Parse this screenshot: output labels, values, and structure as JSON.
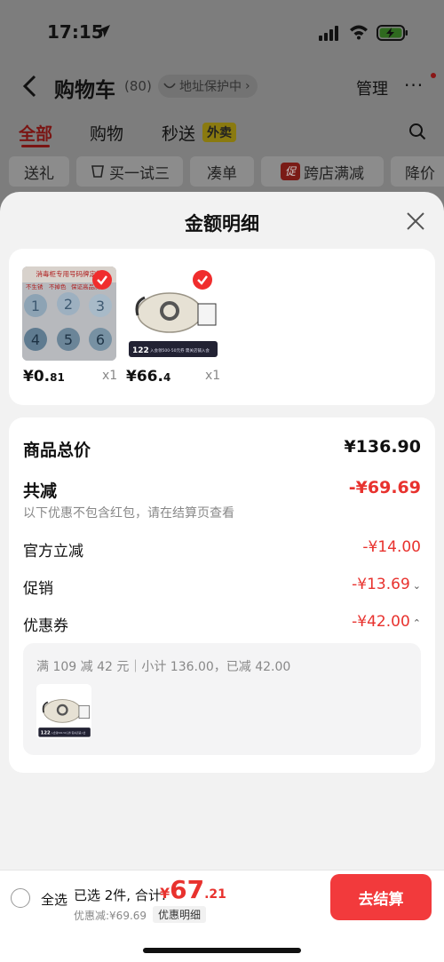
{
  "status": {
    "time": "17:15"
  },
  "nav": {
    "title": "购物车",
    "count": "(80)",
    "address": "地址保护中",
    "manage": "管理",
    "more": "···"
  },
  "tabs": [
    {
      "label": "全部",
      "active": true
    },
    {
      "label": "购物",
      "active": false
    },
    {
      "label": "秒送",
      "active": false
    }
  ],
  "tab_badge": "外卖",
  "chips": [
    "送礼",
    "买一试三",
    "凑单",
    "跨店满减",
    "降价"
  ],
  "chip_promo_badge": "促",
  "sheet": {
    "title": "金额明细",
    "products": [
      {
        "price_int": "¥0.",
        "price_dec": "81",
        "qty": "x1"
      },
      {
        "price_int": "¥66.",
        "price_dec": "4",
        "qty": "x1"
      }
    ],
    "product1_image_text": [
      "消毒柜专用号码牌定制",
      "不生锈",
      "不掉色",
      "保证高品质"
    ],
    "product1_tags": [
      "1",
      "2",
      "3",
      "4",
      "5",
      "6"
    ],
    "product2_image_text": {
      "price": "122",
      "caption": "入会领500-50元券 需关店铺入会"
    },
    "subtotal_label": "商品总价",
    "subtotal_value": "¥136.90",
    "discount_label": "共减",
    "discount_value": "-¥69.69",
    "discount_note": "以下优惠不包含红包，请在结算页查看",
    "rows": [
      {
        "label": "官方立减",
        "value": "-¥14.00",
        "caret": ""
      },
      {
        "label": "促销",
        "value": "-¥13.69",
        "caret": "⌄"
      },
      {
        "label": "优惠券",
        "value": "-¥42.00",
        "caret": "⌃"
      }
    ],
    "coupon_detail": "满 109 减 42 元｜小计 136.00，已减 42.00"
  },
  "bottom": {
    "select_all": "全选",
    "selected": "已选 2件, 合计:",
    "currency": "¥",
    "total_int": "67",
    "total_dec": ".21",
    "discount": "优惠减:¥69.69",
    "detail": "优惠明细",
    "checkout": "去结算"
  },
  "colors": {
    "accent": "#e8322e",
    "checkout": "#f23a3c"
  }
}
